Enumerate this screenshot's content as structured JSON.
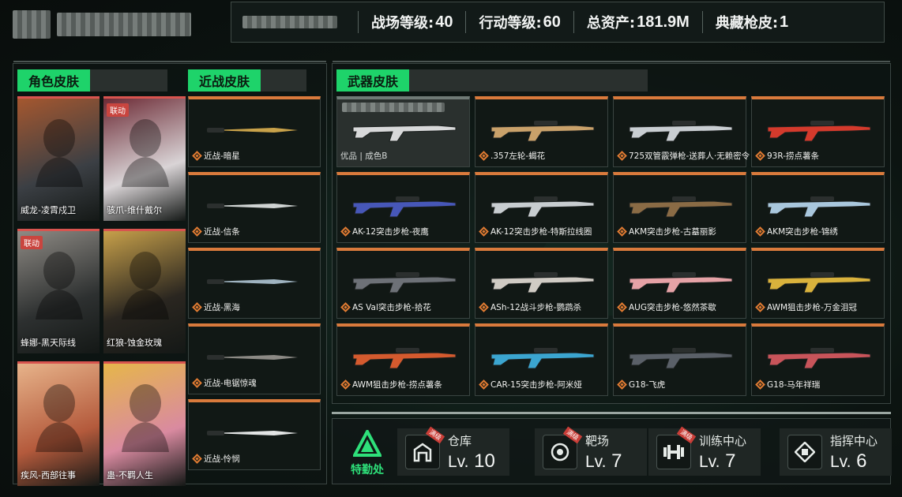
{
  "header": {
    "stats": [
      {
        "label": "战场等级:",
        "value": "40"
      },
      {
        "label": "行动等级:",
        "value": "60"
      },
      {
        "label": "总资产:",
        "value": "181.9M"
      },
      {
        "label": "典藏枪皮:",
        "value": "1"
      }
    ]
  },
  "sections": {
    "character": "角色皮肤",
    "melee": "近战皮肤",
    "weapon": "武器皮肤"
  },
  "characters": [
    {
      "name": "威龙-凌霄戍卫",
      "tag": "",
      "color1": "#3b3f44",
      "color2": "#a4572f"
    },
    {
      "name": "骇爪-维什戴尔",
      "tag": "联动",
      "color1": "#d9d4d6",
      "color2": "#6c2a35"
    },
    {
      "name": "蜂娜-黑天际线",
      "tag": "联动",
      "color1": "#2d3030",
      "color2": "#8e8a84"
    },
    {
      "name": "红狼-蚀金玫瑰",
      "tag": "",
      "color1": "#2a2620",
      "color2": "#c7a04a"
    },
    {
      "name": "疾风-西部往事",
      "tag": "",
      "color1": "#b45a3c",
      "color2": "#e7b38a"
    },
    {
      "name": "蛊-不羁人生",
      "tag": "",
      "color1": "#d98aa0",
      "color2": "#e6b64a"
    }
  ],
  "melee": [
    {
      "name": "近战-暗星",
      "color": "#c9a24a"
    },
    {
      "name": "近战-信条",
      "color": "#cfd3d2"
    },
    {
      "name": "近战-黑海",
      "color": "#9fb3c0"
    },
    {
      "name": "近战-电锯惊魂",
      "color": "#8c8a85"
    },
    {
      "name": "近战-怜悯",
      "color": "#e2e4e4"
    }
  ],
  "weapons": [
    {
      "name": "优品 | 成色B",
      "color": "#d8d9da",
      "selected": true
    },
    {
      "name": ".357左轮-蝎花",
      "color": "#c9a16a"
    },
    {
      "name": "725双管霰弹枪-送葬人·无赖密令",
      "color": "#c9ced2"
    },
    {
      "name": "93R-捞点薯条",
      "color": "#d43a2c"
    },
    {
      "name": "AK-12突击步枪-夜鹰",
      "color": "#4757b8"
    },
    {
      "name": "AK-12突击步枪-特斯拉线圈",
      "color": "#c8cdd0"
    },
    {
      "name": "AKM突击步枪-古墓丽影",
      "color": "#8a6b45"
    },
    {
      "name": "AKM突击步枪-锦绣",
      "color": "#a9c7dd"
    },
    {
      "name": "AS Val突击步枪-拾花",
      "color": "#6d7177"
    },
    {
      "name": "ASh-12战斗步枪-鹦鹉杀",
      "color": "#d0cbc4"
    },
    {
      "name": "AUG突击步枪-悠然茶歇",
      "color": "#e6a2a6"
    },
    {
      "name": "AWM狙击步枪-万金泪冠",
      "color": "#d9b23c"
    },
    {
      "name": "AWM狙击步枪-捞点薯条",
      "color": "#d45a2e"
    },
    {
      "name": "CAR-15突击步枪-阿米娅",
      "color": "#3ba5d0"
    },
    {
      "name": "G18-飞虎",
      "color": "#5a6068"
    },
    {
      "name": "G18-马年祥瑞",
      "color": "#c8545a"
    }
  ],
  "footer": {
    "logo_text": "特勤处",
    "facilities": [
      {
        "name": "仓库",
        "lv_prefix": "Lv.",
        "level": "10",
        "icon": "warehouse-icon",
        "ribbon": "满级"
      },
      {
        "name": "靶场",
        "lv_prefix": "Lv.",
        "level": "7",
        "icon": "target-icon",
        "ribbon": "满级"
      },
      {
        "name": "训练中心",
        "lv_prefix": "Lv.",
        "level": "7",
        "icon": "dumbbell-icon",
        "ribbon": "满级"
      },
      {
        "name": "指挥中心",
        "lv_prefix": "Lv.",
        "level": "6",
        "icon": "command-icon",
        "ribbon": ""
      }
    ]
  },
  "colors": {
    "accent_green": "#1ed36a",
    "accent_orange": "#d97a3c",
    "tag_red": "#c9453f"
  }
}
